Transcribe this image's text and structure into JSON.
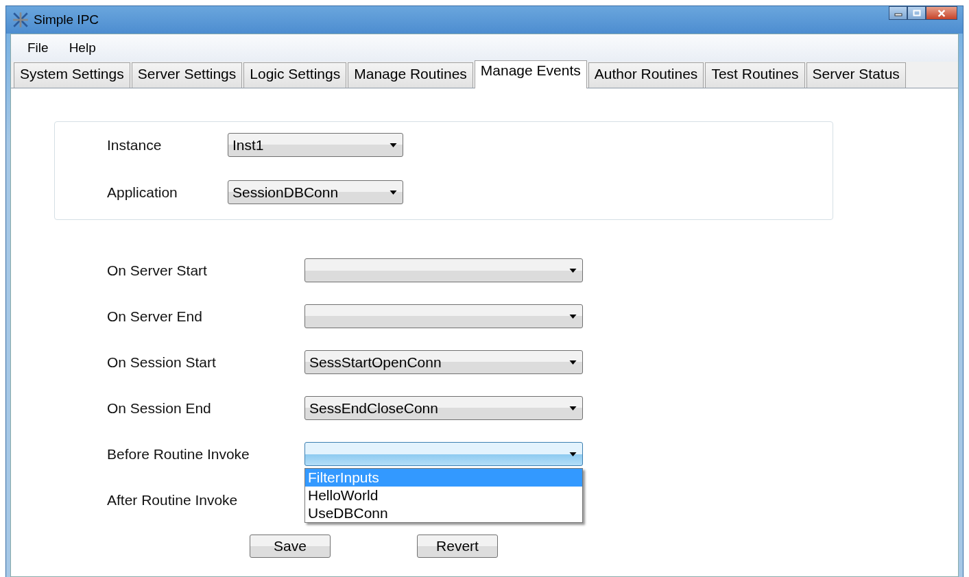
{
  "window": {
    "title": "Simple IPC"
  },
  "menu": [
    "File",
    "Help"
  ],
  "tabs": [
    {
      "label": "System Settings",
      "selected": false
    },
    {
      "label": "Server Settings",
      "selected": false
    },
    {
      "label": "Logic Settings",
      "selected": false
    },
    {
      "label": "Manage Routines",
      "selected": false
    },
    {
      "label": "Manage Events",
      "selected": true
    },
    {
      "label": "Author Routines",
      "selected": false
    },
    {
      "label": "Test Routines",
      "selected": false
    },
    {
      "label": "Server Status",
      "selected": false
    }
  ],
  "scope": [
    {
      "label": "Instance",
      "value": "Inst1"
    },
    {
      "label": "Application",
      "value": "SessionDBConn"
    }
  ],
  "events": [
    {
      "label": "On Server Start",
      "kind": "dropdown",
      "open": false
    },
    {
      "label": "On Server End",
      "kind": "dropdown",
      "open": false
    },
    {
      "label": "On Session Start",
      "kind": "dropdown",
      "open": false,
      "value": "SessStartOpenConn"
    },
    {
      "label": "On Session End",
      "kind": "dropdown",
      "open": false,
      "value": "SessEndCloseConn"
    },
    {
      "label": "Before Routine Invoke",
      "kind": "dropdown",
      "open": true,
      "options": [
        {
          "label": "FilterInputs",
          "selected": true
        },
        {
          "label": "HelloWorld",
          "selected": false
        },
        {
          "label": "UseDBConn",
          "selected": false
        }
      ]
    },
    {
      "label": "After Routine Invoke",
      "kind": "covered"
    }
  ],
  "buttons": [
    "Save",
    "Revert"
  ]
}
